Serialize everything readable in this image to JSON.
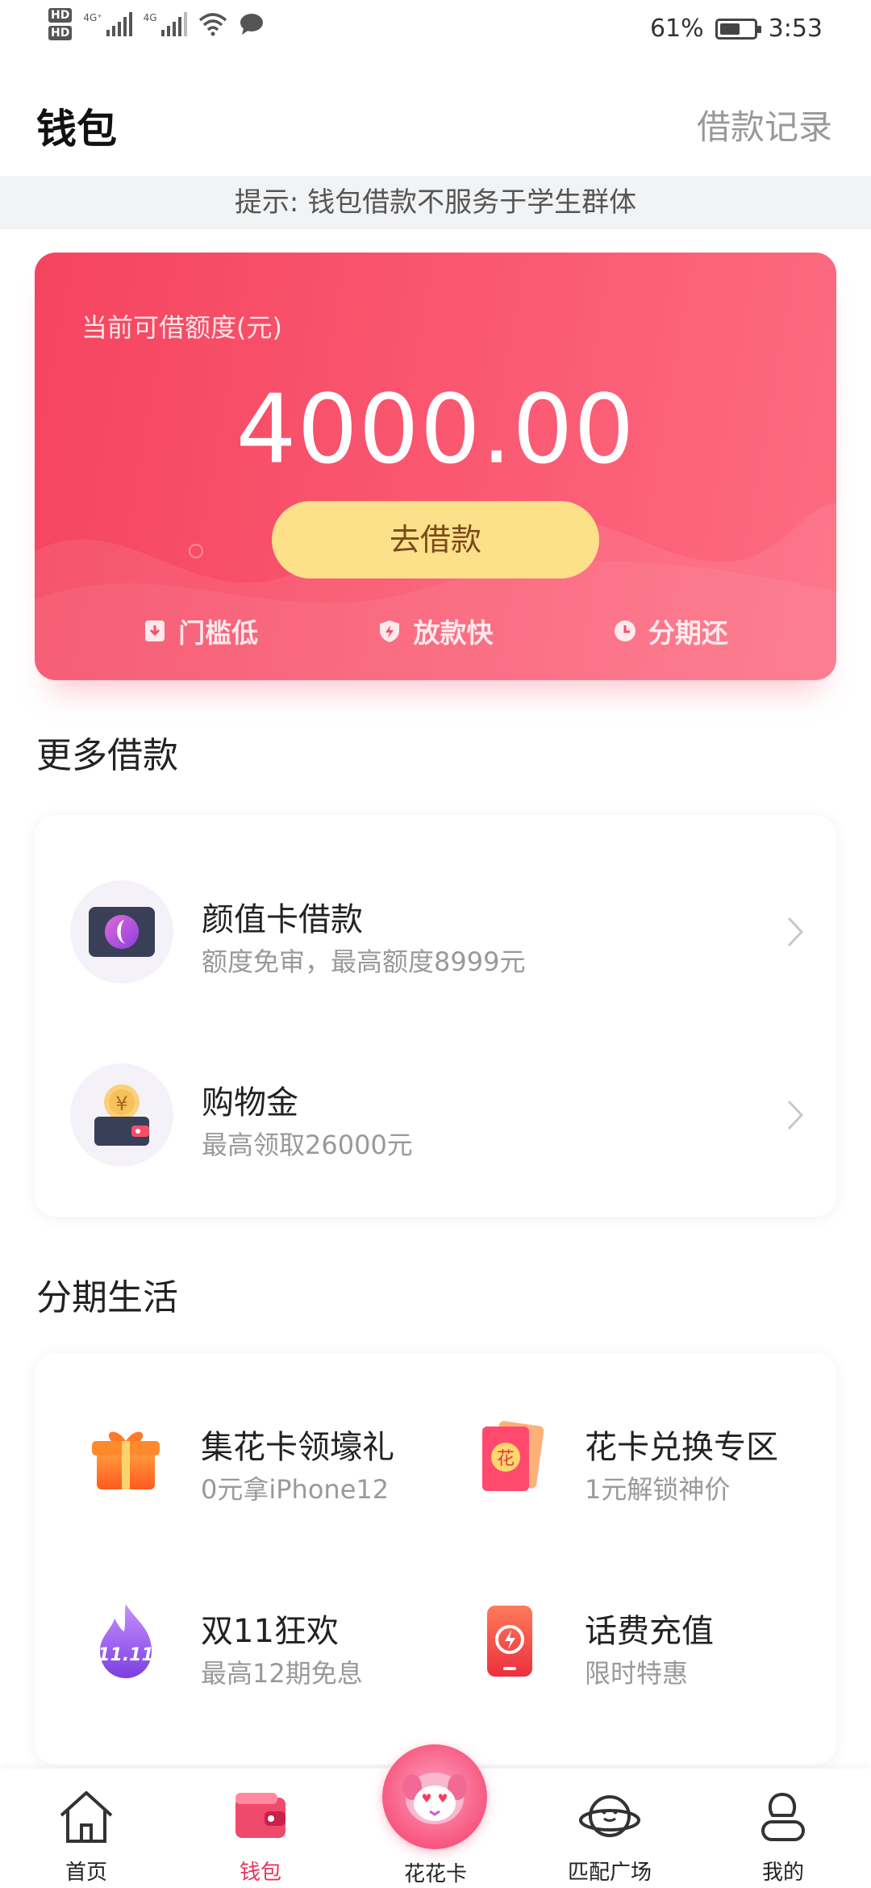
{
  "status_bar": {
    "hd1": "HD",
    "hd2": "HD",
    "net1": "4G⁺",
    "net2": "4G",
    "battery_percent": "61%",
    "battery_level": 0.61,
    "time": "3:53"
  },
  "header": {
    "title": "钱包",
    "loan_record": "借款记录"
  },
  "notice": "提示: 钱包借款不服务于学生群体",
  "credit": {
    "label": "当前可借额度(元)",
    "amount": "4000.00",
    "borrow_button": "去借款",
    "features": [
      "门槛低",
      "放款快",
      "分期还"
    ]
  },
  "more_loans": {
    "title": "更多借款",
    "items": [
      {
        "title": "颜值卡借款",
        "subtitle": "额度免审，最高额度8999元",
        "icon": "face-card-icon"
      },
      {
        "title": "购物金",
        "subtitle": "最高领取26000元",
        "icon": "wallet-coin-icon"
      }
    ]
  },
  "installment": {
    "title": "分期生活",
    "items": [
      {
        "title": "集花卡领壕礼",
        "subtitle": "0元拿iPhone12",
        "icon": "gift-icon"
      },
      {
        "title": "花卡兑换专区",
        "subtitle": "1元解锁神价",
        "icon": "flower-card-icon"
      },
      {
        "title": "双11狂欢",
        "subtitle": "最高12期免息",
        "icon": "double-eleven-icon"
      },
      {
        "title": "话费充值",
        "subtitle": "限时特惠",
        "icon": "phone-recharge-icon"
      }
    ]
  },
  "bottom_nav": {
    "items": [
      {
        "label": "首页",
        "icon": "home-icon"
      },
      {
        "label": "钱包",
        "icon": "wallet-icon",
        "active": true
      },
      {
        "label": "花花卡",
        "icon": "mascot-icon"
      },
      {
        "label": "匹配广场",
        "icon": "planet-icon"
      },
      {
        "label": "我的",
        "icon": "profile-icon"
      }
    ]
  },
  "colors": {
    "card_red": "#f5445f",
    "button_yellow": "#fde08a",
    "active_nav": "#e8345a"
  }
}
